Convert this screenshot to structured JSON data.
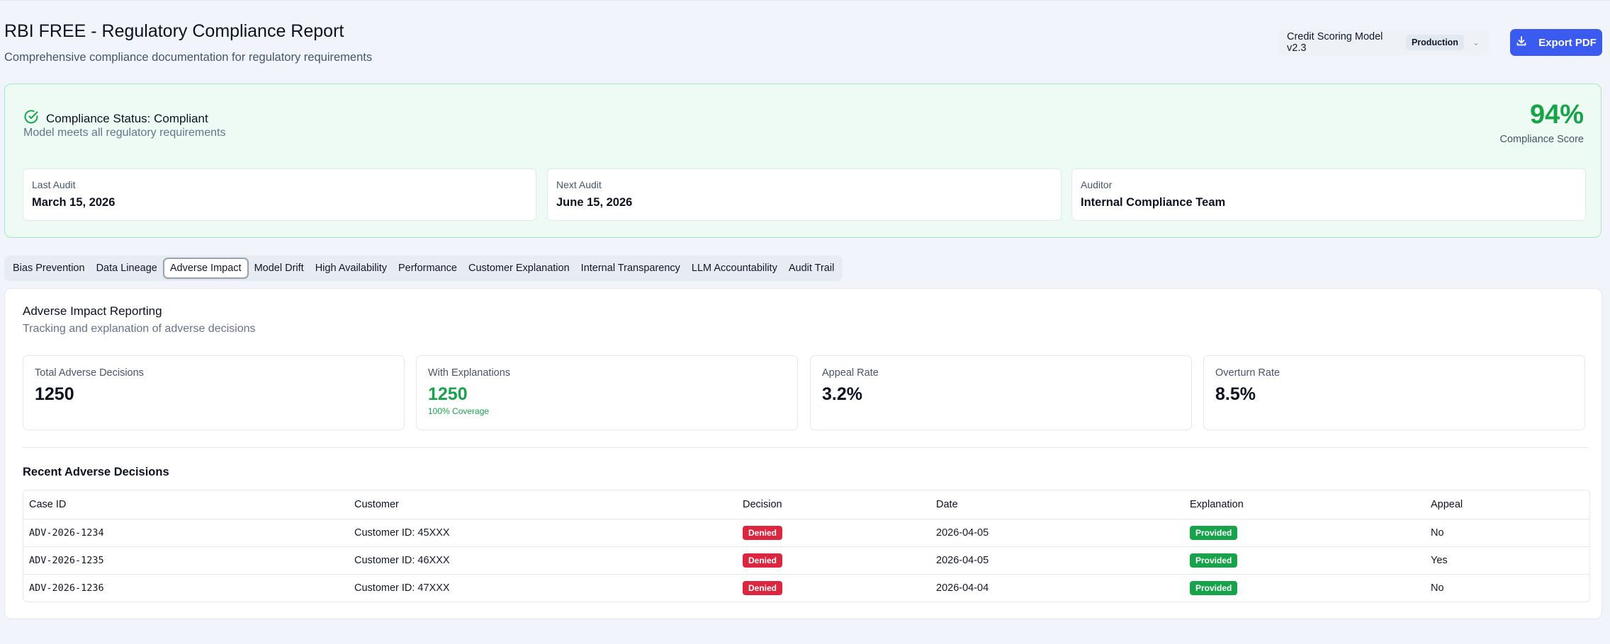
{
  "header": {
    "title": "RBI FREE - Regulatory Compliance Report",
    "subtitle": "Comprehensive compliance documentation for regulatory requirements",
    "model_name": "Credit Scoring Model v2.3",
    "environment": "Production",
    "export_label": "Export PDF"
  },
  "compliance": {
    "status_title": "Compliance Status: Compliant",
    "status_desc": "Model meets all regulatory requirements",
    "score": "94%",
    "score_label": "Compliance Score",
    "audits": [
      {
        "label": "Last Audit",
        "value": "March 15, 2026"
      },
      {
        "label": "Next Audit",
        "value": "June 15, 2026"
      },
      {
        "label": "Auditor",
        "value": "Internal Compliance Team"
      }
    ]
  },
  "tabs": [
    "Bias Prevention",
    "Data Lineage",
    "Adverse Impact",
    "Model Drift",
    "High Availability",
    "Performance",
    "Customer Explanation",
    "Internal Transparency",
    "LLM Accountability",
    "Audit Trail"
  ],
  "active_tab": "Adverse Impact",
  "section": {
    "title": "Adverse Impact Reporting",
    "desc": "Tracking and explanation of adverse decisions",
    "metrics": [
      {
        "label": "Total Adverse Decisions",
        "value": "1250"
      },
      {
        "label": "With Explanations",
        "value": "1250",
        "sub": "100% Coverage"
      },
      {
        "label": "Appeal Rate",
        "value": "3.2%"
      },
      {
        "label": "Overturn Rate",
        "value": "8.5%"
      }
    ],
    "table_title": "Recent Adverse Decisions",
    "columns": [
      "Case ID",
      "Customer",
      "Decision",
      "Date",
      "Explanation",
      "Appeal"
    ],
    "rows": [
      {
        "case_id": "ADV-2026-1234",
        "customer": "Customer ID: 45XXX",
        "decision": "Denied",
        "date": "2026-04-05",
        "explanation": "Provided",
        "appeal": "No"
      },
      {
        "case_id": "ADV-2026-1235",
        "customer": "Customer ID: 46XXX",
        "decision": "Denied",
        "date": "2026-04-05",
        "explanation": "Provided",
        "appeal": "Yes"
      },
      {
        "case_id": "ADV-2026-1236",
        "customer": "Customer ID: 47XXX",
        "decision": "Denied",
        "date": "2026-04-04",
        "explanation": "Provided",
        "appeal": "No"
      }
    ]
  },
  "colors": {
    "accent": "#3b5bf0",
    "success": "#16a34a",
    "danger": "#dc2640"
  }
}
